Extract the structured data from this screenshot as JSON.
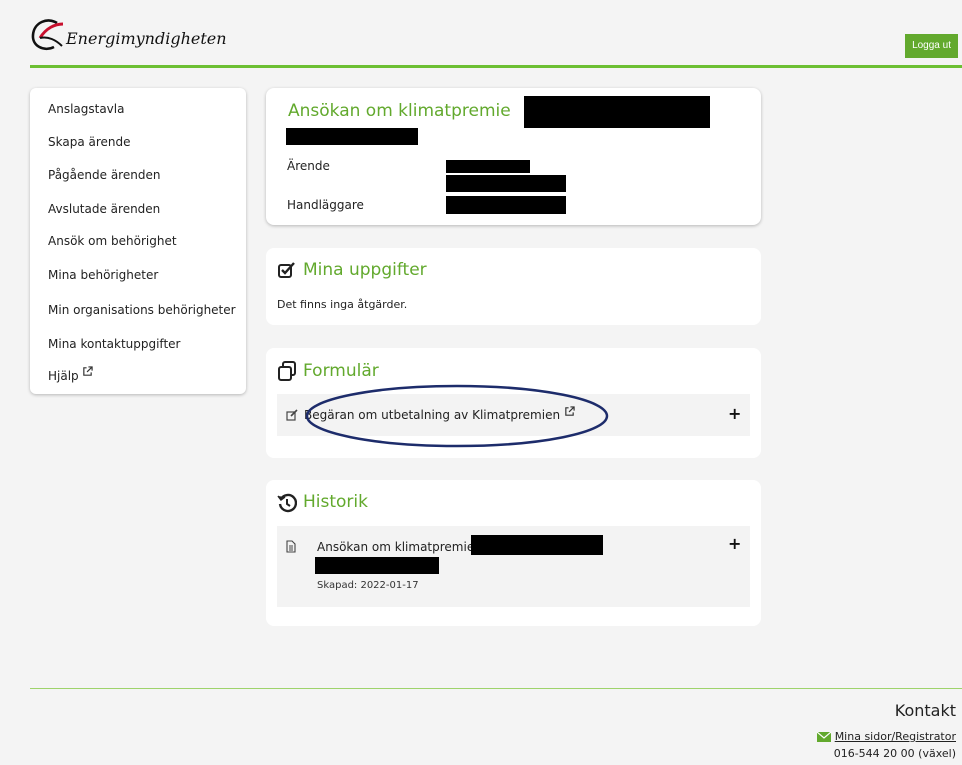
{
  "header": {
    "logo_text": "Energimyndigheten",
    "logout_label": "Logga ut"
  },
  "sidebar": {
    "items": [
      {
        "label": "Anslagstavla"
      },
      {
        "label": "Skapa ärende"
      },
      {
        "label": "Pågående ärenden"
      },
      {
        "label": "Avslutade ärenden"
      },
      {
        "label": "Ansök om behörighet"
      },
      {
        "label": "Mina behörigheter"
      },
      {
        "label": "Min organisations behörigheter"
      },
      {
        "label": "Mina kontaktuppgifter"
      },
      {
        "label": "Hjälp"
      }
    ]
  },
  "case": {
    "title": "Ansökan om klimatpremie",
    "arende_label": "Ärende",
    "handlaggare_label": "Handläggare"
  },
  "tasks": {
    "title": "Mina uppgifter",
    "empty_text": "Det finns inga åtgärder."
  },
  "forms": {
    "title": "Formulär",
    "item_label": "Begäran om utbetalning av Klimatpremien"
  },
  "history": {
    "title": "Historik",
    "item_title": "Ansökan om klimatpremie",
    "item_created": "Skapad: 2022-01-17"
  },
  "footer": {
    "contact_title": "Kontakt",
    "link_label": "Mina sidor/Registrator",
    "phone": "016-544 20 00 (växel)"
  },
  "colors": {
    "brand_green": "#62a92d",
    "line_green": "#6cbf32",
    "annotation_navy": "#1d2c6b"
  }
}
